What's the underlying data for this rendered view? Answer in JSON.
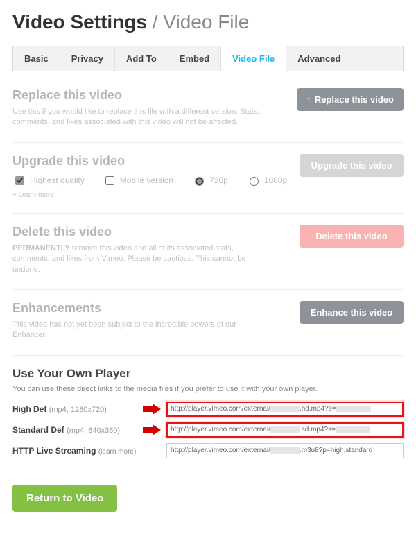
{
  "title": {
    "main": "Video Settings",
    "slash": "/",
    "sub": "Video File"
  },
  "tabs": [
    "Basic",
    "Privacy",
    "Add To",
    "Embed",
    "Video File",
    "Advanced"
  ],
  "activeTab": 4,
  "replace": {
    "heading": "Replace this video",
    "desc": "Use this if you would like to replace this file with a different version. Stats, comments, and likes associated with this video will not be affected.",
    "button": "Replace this video"
  },
  "upgrade": {
    "heading": "Upgrade this video",
    "opts": {
      "quality": "Highest quality",
      "mobile": "Mobile version",
      "r720": "720p",
      "r1080": "1080p"
    },
    "learn": "+ Learn more",
    "button": "Upgrade this video"
  },
  "del": {
    "heading": "Delete this video",
    "perm": "PERMANENTLY",
    "desc": " remove this video and all of its associated stats, comments, and likes from Vimeo. Please be cautious. This cannot be undone.",
    "button": "Delete this video"
  },
  "enh": {
    "heading": "Enhancements",
    "desc": "This video has not yet been subject to the incredible powers of our Enhancer.",
    "button": "Enhance this video"
  },
  "player": {
    "heading": "Use Your Own Player",
    "desc": "You can use these direct links to the media files if you prefer to use it with your own player.",
    "rows": {
      "hd": {
        "label": "High Def",
        "fmt": "(mp4, 1280x720)",
        "u1": "http://player.vimeo.com/external/",
        "u2": ".hd.mp4?s="
      },
      "sd": {
        "label": "Standard Def",
        "fmt": "(mp4, 640x360)",
        "u1": "http://player.vimeo.com/external/",
        "u2": ".sd.mp4?s="
      },
      "hls": {
        "label": "HTTP Live Streaming",
        "learn": "(learn more)",
        "u1": "http://player.vimeo.com/external/",
        "u2": ".m3u8?p=high,standard"
      }
    }
  },
  "return_btn": "Return to Video"
}
